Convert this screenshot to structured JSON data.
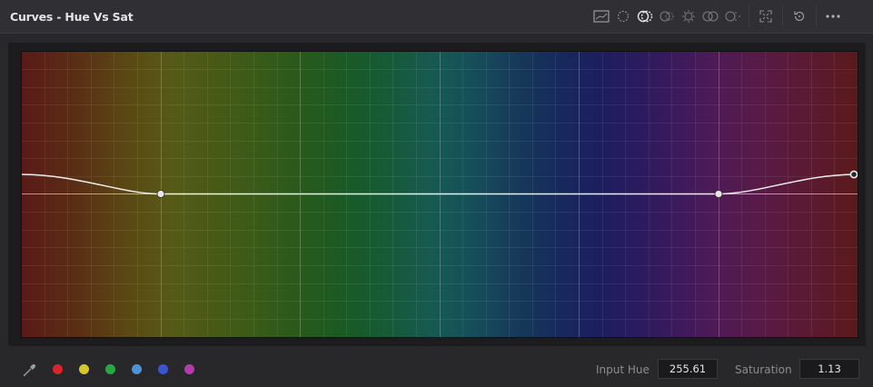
{
  "panel": {
    "title": "Curves - Hue Vs Sat"
  },
  "toolbar": {
    "icons": [
      "reset-graph-icon",
      "hue-channel-icon",
      "hue-sat-icon",
      "hue-lum-icon",
      "lum-sat-icon",
      "sat-sat-icon",
      "sat-lum-icon",
      "expand-icon",
      "reset-icon",
      "more-options-icon"
    ]
  },
  "swatches": [
    {
      "name": "red-swatch",
      "color": "#d8252b"
    },
    {
      "name": "yellow-swatch",
      "color": "#d8c52a"
    },
    {
      "name": "green-swatch",
      "color": "#27a845"
    },
    {
      "name": "cyan-swatch",
      "color": "#4a94d6"
    },
    {
      "name": "blue-swatch",
      "color": "#3a55d0"
    },
    {
      "name": "magenta-swatch",
      "color": "#b53ab0"
    }
  ],
  "readouts": {
    "input_hue_label": "Input Hue",
    "input_hue_value": "255.61",
    "saturation_label": "Saturation",
    "saturation_value": "1.13"
  }
}
